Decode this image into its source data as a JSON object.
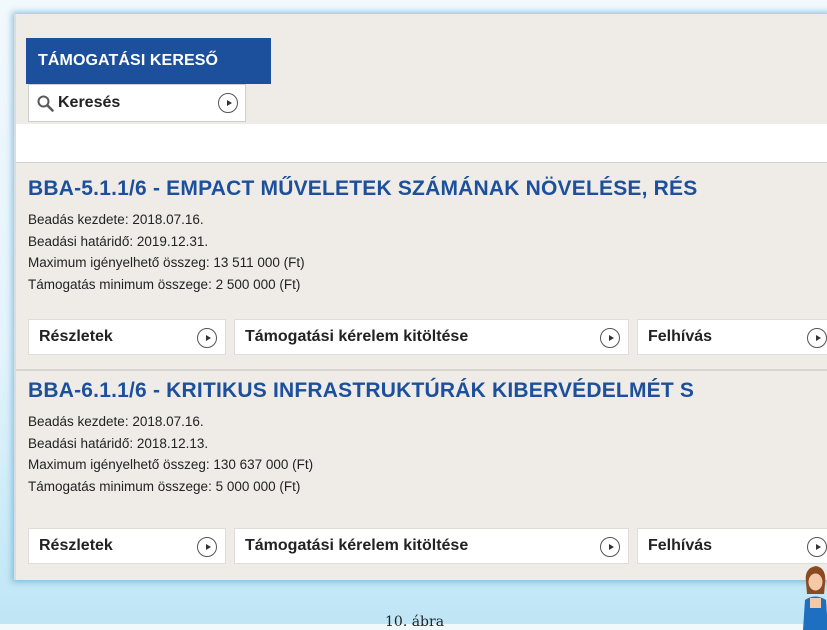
{
  "header": {
    "brand": "TÁMOGATÁSI KERESŐ"
  },
  "search": {
    "label": "Keresés"
  },
  "items": [
    {
      "title": "BBA-5.1.1/6 - EMPACT MŰVELETEK SZÁMÁNAK NÖVELÉSE, RÉS",
      "start": "Beadás kezdete: 2018.07.16.",
      "deadline": "Beadási határidő: 2019.12.31.",
      "max": "Maximum igényelhető összeg: 13 511 000 (Ft)",
      "min": "Támogatás minimum összege: 2 500 000 (Ft)",
      "actions": [
        "Részletek",
        "Támogatási kérelem kitöltése",
        "Felhívás"
      ]
    },
    {
      "title": "BBA-6.1.1/6 - KRITIKUS INFRASTRUKTÚRÁK KIBERVÉDELMÉT S",
      "start": "Beadás kezdete: 2018.07.16.",
      "deadline": "Beadási határidő: 2018.12.13.",
      "max": "Maximum igényelhető összeg: 130 637 000 (Ft)",
      "min": "Támogatás minimum összege: 5 000 000 (Ft)",
      "actions": [
        "Részletek",
        "Támogatási kérelem kitöltése",
        "Felhívás"
      ]
    }
  ],
  "caption": "10. ábra",
  "colors": {
    "brand_bg": "#1c4f9c",
    "title": "#1c4f9c",
    "panel": "#efece7"
  },
  "icons": {
    "search": "search-icon",
    "go": "circle-play-icon"
  }
}
